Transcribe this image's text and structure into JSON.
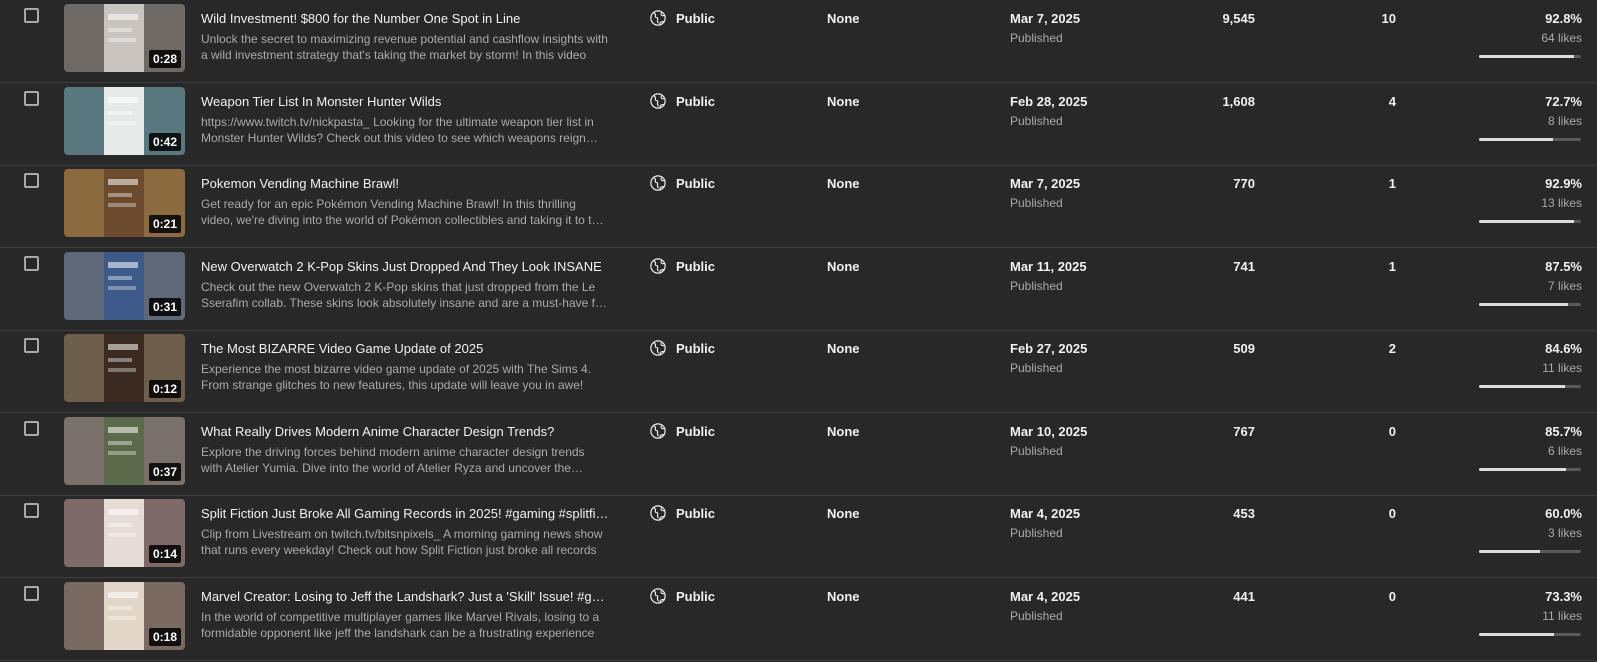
{
  "rows": [
    {
      "title": "Wild Investment! $800 for the Number One Spot in Line",
      "description": "Unlock the secret to maximizing revenue potential and cashflow insights with a wild investment strategy that's taking the market by storm! In this video",
      "duration": "0:28",
      "visibility": "Public",
      "restrictions": "None",
      "date": "Mar 7, 2025",
      "status": "Published",
      "views": "9,545",
      "comments": "10",
      "like_ratio": "92.8%",
      "likes": "64 likes",
      "like_fraction": 0.928,
      "thumb_bg": "#6f6a66",
      "thumb_accent": "#c9c4c0"
    },
    {
      "title": "Weapon Tier List In Monster Hunter Wilds",
      "description": "https://www.twitch.tv/nickpasta_ Looking for the ultimate weapon tier list in Monster Hunter Wilds? Check out this video to see which weapons reign supreme",
      "duration": "0:42",
      "visibility": "Public",
      "restrictions": "None",
      "date": "Feb 28, 2025",
      "status": "Published",
      "views": "1,608",
      "comments": "4",
      "like_ratio": "72.7%",
      "likes": "8 likes",
      "like_fraction": 0.727,
      "thumb_bg": "#5a7880",
      "thumb_accent": "#e8eaea"
    },
    {
      "title": "Pokemon Vending Machine Brawl!",
      "description": "Get ready for an epic Pokémon Vending Machine Brawl! In this thrilling video, we're diving into the world of Pokémon collectibles and taking it to the next level",
      "duration": "0:21",
      "visibility": "Public",
      "restrictions": "None",
      "date": "Mar 7, 2025",
      "status": "Published",
      "views": "770",
      "comments": "1",
      "like_ratio": "92.9%",
      "likes": "13 likes",
      "like_fraction": 0.929,
      "thumb_bg": "#8a6a3e",
      "thumb_accent": "#6b4a2e"
    },
    {
      "title": "New Overwatch 2 K-Pop Skins Just Dropped And They Look INSANE",
      "description": "Check out the new Overwatch 2 K-Pop skins that just dropped from the Le Sserafim collab. These skins look absolutely insane and are a must-have for fans",
      "duration": "0:31",
      "visibility": "Public",
      "restrictions": "None",
      "date": "Mar 11, 2025",
      "status": "Published",
      "views": "741",
      "comments": "1",
      "like_ratio": "87.5%",
      "likes": "7 likes",
      "like_fraction": 0.875,
      "thumb_bg": "#5e6878",
      "thumb_accent": "#3e5a8a"
    },
    {
      "title": "The Most BIZARRE Video Game Update of 2025",
      "description": "Experience the most bizarre video game update of 2025 with The Sims 4. From strange glitches to new features, this update will leave you in awe!",
      "duration": "0:12",
      "visibility": "Public",
      "restrictions": "None",
      "date": "Feb 27, 2025",
      "status": "Published",
      "views": "509",
      "comments": "2",
      "like_ratio": "84.6%",
      "likes": "11 likes",
      "like_fraction": 0.846,
      "thumb_bg": "#6e5e4c",
      "thumb_accent": "#3a2a22"
    },
    {
      "title": "What Really Drives Modern Anime Character Design Trends?",
      "description": "Explore the driving forces behind modern anime character design trends with Atelier Yumia. Dive into the world of Atelier Ryza and uncover the secrets",
      "duration": "0:37",
      "visibility": "Public",
      "restrictions": "None",
      "date": "Mar 10, 2025",
      "status": "Published",
      "views": "767",
      "comments": "0",
      "like_ratio": "85.7%",
      "likes": "6 likes",
      "like_fraction": 0.857,
      "thumb_bg": "#7a726a",
      "thumb_accent": "#5a6a4a"
    },
    {
      "title": "Split Fiction Just Broke All Gaming Records in 2025! #gaming #splitfiction",
      "description": "Clip from Livestream on twitch.tv/bitsnpixels_ A morning gaming news show that runs every weekday! Check out how Split Fiction just broke all records",
      "duration": "0:14",
      "visibility": "Public",
      "restrictions": "None",
      "date": "Mar 4, 2025",
      "status": "Published",
      "views": "453",
      "comments": "0",
      "like_ratio": "60.0%",
      "likes": "3 likes",
      "like_fraction": 0.6,
      "thumb_bg": "#7e6a66",
      "thumb_accent": "#e6dcd6"
    },
    {
      "title": "Marvel Creator: Losing to Jeff the Landshark? Just a 'Skill' Issue! #gaming",
      "description": "In the world of competitive multiplayer games like Marvel Rivals, losing to a formidable opponent like jeff the landshark can be a frustrating experience",
      "duration": "0:18",
      "visibility": "Public",
      "restrictions": "None",
      "date": "Mar 4, 2025",
      "status": "Published",
      "views": "441",
      "comments": "0",
      "like_ratio": "73.3%",
      "likes": "11 likes",
      "like_fraction": 0.733,
      "thumb_bg": "#7a6a62",
      "thumb_accent": "#e2d6c8"
    }
  ],
  "icons": {
    "visibility": "globe-icon",
    "checkbox": "checkbox-icon"
  },
  "colors": {
    "background": "#282828",
    "row_divider": "#3d3d3d",
    "secondary_text": "#aaaaaa",
    "bar_track": "#5a5a5a",
    "bar_fill": "#dddddd"
  }
}
